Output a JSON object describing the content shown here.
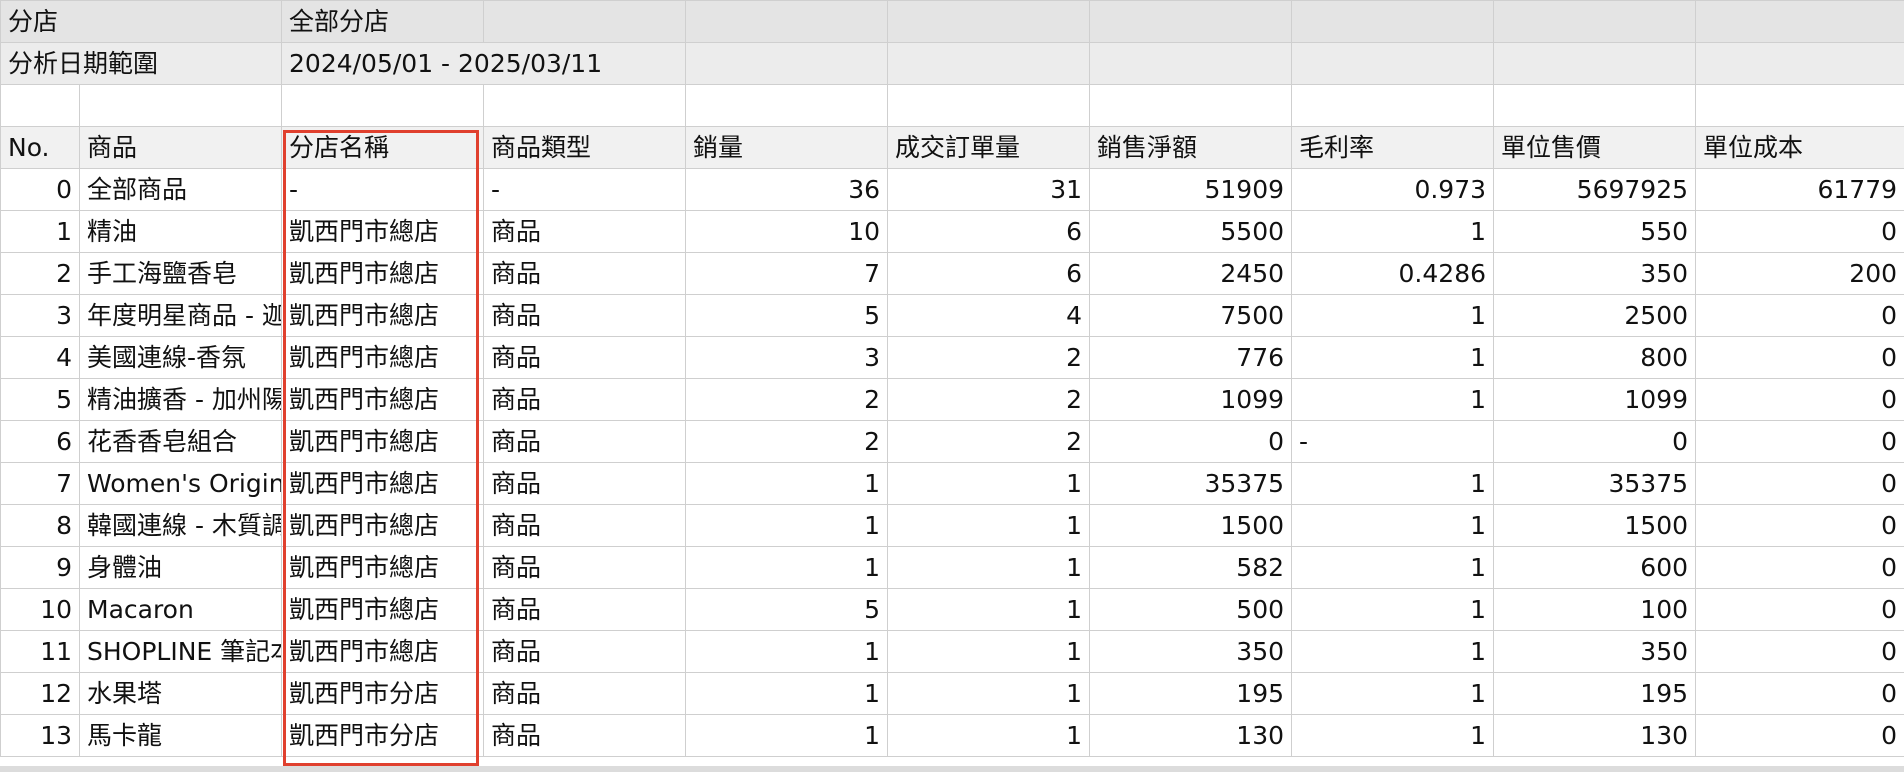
{
  "meta": {
    "store_label": "分店",
    "store_value": "全部分店",
    "date_label": "分析日期範圍",
    "date_value": "2024/05/01 - 2025/03/11"
  },
  "columns": [
    "No.",
    "商品",
    "分店名稱",
    "商品類型",
    "銷量",
    "成交訂單量",
    "銷售淨額",
    "毛利率",
    "單位售價",
    "單位成本"
  ],
  "rows": [
    [
      "0",
      "全部商品",
      "-",
      "-",
      "36",
      "31",
      "51909",
      "0.973",
      "5697925",
      "61779"
    ],
    [
      "1",
      "精油",
      "凱西門市總店",
      "商品",
      "10",
      "6",
      "5500",
      "1",
      "550",
      "0"
    ],
    [
      "2",
      "手工海鹽香皂",
      "凱西門市總店",
      "商品",
      "7",
      "6",
      "2450",
      "0.4286",
      "350",
      "200"
    ],
    [
      "3",
      "年度明星商品 - 迦",
      "凱西門市總店",
      "商品",
      "5",
      "4",
      "7500",
      "1",
      "2500",
      "0"
    ],
    [
      "4",
      "美國連線-香氛",
      "凱西門市總店",
      "商品",
      "3",
      "2",
      "776",
      "1",
      "800",
      "0"
    ],
    [
      "5",
      "精油擴香 - 加州陽",
      "凱西門市總店",
      "商品",
      "2",
      "2",
      "1099",
      "1",
      "1099",
      "0"
    ],
    [
      "6",
      "花香香皂組合",
      "凱西門市總店",
      "商品",
      "2",
      "2",
      "0",
      "-",
      "0",
      "0"
    ],
    [
      "7",
      "Women's Original",
      "凱西門市總店",
      "商品",
      "1",
      "1",
      "35375",
      "1",
      "35375",
      "0"
    ],
    [
      "8",
      "韓國連線 - 木質調",
      "凱西門市總店",
      "商品",
      "1",
      "1",
      "1500",
      "1",
      "1500",
      "0"
    ],
    [
      "9",
      "身體油",
      "凱西門市總店",
      "商品",
      "1",
      "1",
      "582",
      "1",
      "600",
      "0"
    ],
    [
      "10",
      "Macaron",
      "凱西門市總店",
      "商品",
      "5",
      "1",
      "500",
      "1",
      "100",
      "0"
    ],
    [
      "11",
      "SHOPLINE 筆記本",
      "凱西門市總店",
      "商品",
      "1",
      "1",
      "350",
      "1",
      "350",
      "0"
    ],
    [
      "12",
      "水果塔",
      "凱西門市分店",
      "商品",
      "1",
      "1",
      "195",
      "1",
      "195",
      "0"
    ],
    [
      "13",
      "馬卡龍",
      "凱西門市分店",
      "商品",
      "1",
      "1",
      "130",
      "1",
      "130",
      "0"
    ]
  ],
  "highlight_color": "#e0402e"
}
